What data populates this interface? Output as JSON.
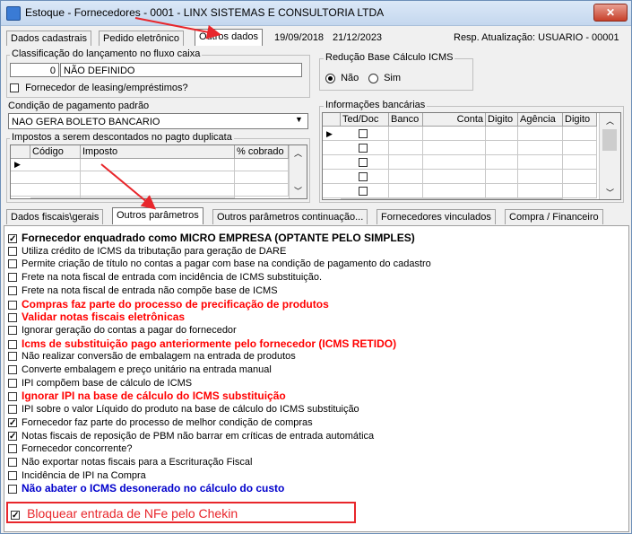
{
  "window": {
    "title": "Estoque - Fornecedores - 0001 - LINX SISTEMAS E CONSULTORIA LTDA",
    "close_label": "✕"
  },
  "top_tabs": [
    {
      "label": "Dados cadastrais"
    },
    {
      "label": "Pedido eletrônico"
    },
    {
      "label": "Outros dados"
    }
  ],
  "header_info": {
    "date1": "19/09/2018",
    "date2": "21/12/2023",
    "resp": "Resp. Atualização: USUARIO - 00001"
  },
  "classificacao": {
    "title": "Classificação do lançamento no fluxo caixa",
    "code": "0",
    "value": "NÃO DEFINIDO",
    "leasing_label": "Fornecedor de leasing/empréstimos?",
    "leasing_checked": false
  },
  "reducao_icms": {
    "title": "Redução Base Cálculo ICMS",
    "opt_nao": "Não",
    "opt_sim": "Sim",
    "selected": "Não"
  },
  "condicao_pagamento": {
    "title": "Condição de pagamento padrão",
    "value": "NAO GERA BOLETO BANCARIO"
  },
  "impostos": {
    "title": "Impostos a serem descontados no pagto duplicata",
    "columns": [
      "Código",
      "Imposto",
      "% cobrado"
    ]
  },
  "bancarias": {
    "title": "Informações bancárias",
    "columns": [
      "Ted/Doc",
      "Banco",
      "Conta",
      "Digito",
      "Agência",
      "Digito"
    ]
  },
  "bottom_tabs": [
    {
      "label": "Dados fiscais\\gerais"
    },
    {
      "label": "Outros parâmetros"
    },
    {
      "label": "Outros parâmetros continuação..."
    },
    {
      "label": "Fornecedores vinculados"
    },
    {
      "label": "Compra / Financeiro"
    }
  ],
  "options": [
    {
      "label": "Fornecedor enquadrado como MICRO EMPRESA (OPTANTE PELO SIMPLES)",
      "checked": true,
      "style": "bold"
    },
    {
      "label": "Utiliza crédito de ICMS da tributação para geração de DARE",
      "checked": false,
      "style": "normal"
    },
    {
      "label": "Permite criação de título no contas a pagar com base na condição de pagamento do cadastro",
      "checked": false,
      "style": "normal"
    },
    {
      "label": "Frete na nota fiscal de entrada com incidência de ICMS substituição.",
      "checked": false,
      "style": "normal"
    },
    {
      "label": "Frete na nota fiscal de entrada não compõe base de ICMS",
      "checked": false,
      "style": "normal"
    },
    {
      "label": "Compras faz parte do processo de precificação de produtos",
      "checked": false,
      "style": "red"
    },
    {
      "label": "Validar notas fiscais eletrônicas",
      "checked": false,
      "style": "red"
    },
    {
      "label": "Ignorar geração do contas a pagar do fornecedor",
      "checked": false,
      "style": "normal"
    },
    {
      "label": "Icms de substituição pago anteriormente pelo fornecedor (ICMS RETIDO)",
      "checked": false,
      "style": "red"
    },
    {
      "label": "Não realizar conversão de embalagem na entrada de produtos",
      "checked": false,
      "style": "normal"
    },
    {
      "label": "Converte embalagem e preço unitário na entrada manual",
      "checked": false,
      "style": "normal"
    },
    {
      "label": "IPI compõem base de cálculo de ICMS",
      "checked": false,
      "style": "normal"
    },
    {
      "label": "Ignorar IPI na base de cálculo do ICMS substituição",
      "checked": false,
      "style": "red"
    },
    {
      "label": "IPI sobre o valor Líquido do produto na base de cálculo do ICMS substituição",
      "checked": false,
      "style": "normal"
    },
    {
      "label": "Fornecedor faz parte do processo de melhor condição de compras",
      "checked": true,
      "style": "normal"
    },
    {
      "label": "Notas fiscais de reposição de PBM não barrar em críticas de entrada automática",
      "checked": true,
      "style": "normal"
    },
    {
      "label": "Fornecedor concorrente?",
      "checked": false,
      "style": "normal"
    },
    {
      "label": "Não exportar notas fiscais para a Escrituração Fiscal",
      "checked": false,
      "style": "normal"
    },
    {
      "label": "Incidência de IPI na Compra",
      "checked": false,
      "style": "normal"
    },
    {
      "label": "Não abater o ICMS desonerado no cálculo do custo",
      "checked": false,
      "style": "blue"
    }
  ],
  "highlighted_option": {
    "label": "Bloquear entrada de NFe pelo Chekin",
    "checked": true
  },
  "annotation_color": "#e8262b"
}
